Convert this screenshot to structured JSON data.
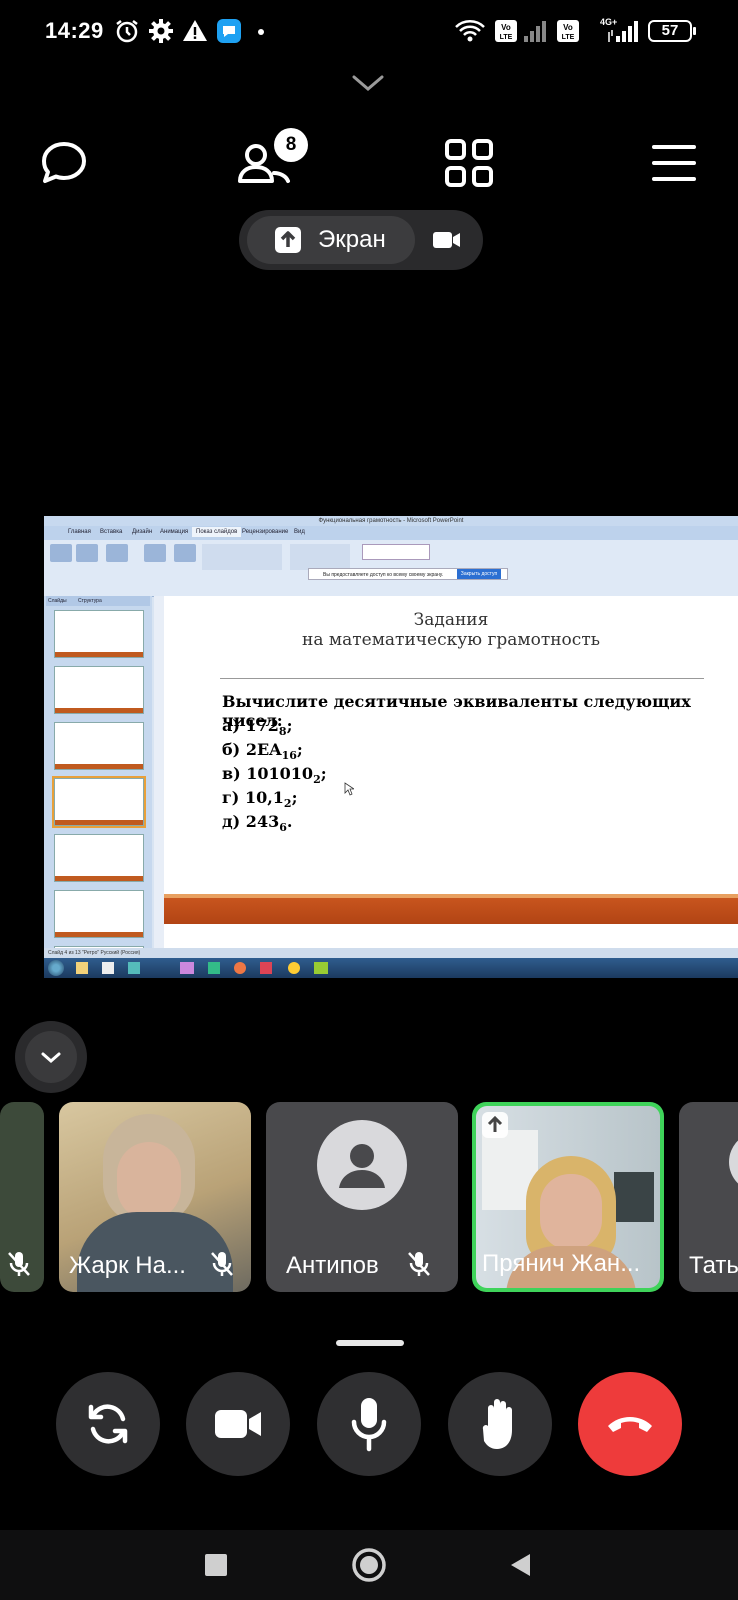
{
  "status_bar": {
    "time": "14:29",
    "icons": [
      "alarm-icon",
      "gear-icon",
      "warning-icon",
      "chat-app-icon",
      "dot-icon",
      "wifi-icon",
      "volte-icon",
      "signal-icon",
      "volte-icon",
      "signal-4g-icon"
    ],
    "network_label": "4G+",
    "battery": "57"
  },
  "toolbar": {
    "participants_count": "8",
    "icons": [
      "chat-icon",
      "participants-icon",
      "grid-icon",
      "menu-icon"
    ]
  },
  "share_pill": {
    "label": "Экран"
  },
  "shared_screen": {
    "window_title": "Функциональная грамотность - Microsoft PowerPoint",
    "ribbon_tabs": [
      "Главная",
      "Вставка",
      "Дизайн",
      "Анимация",
      "Показ слайдов",
      "Рецензирование",
      "Вид"
    ],
    "notice_text": "Вы предоставляете доступ ко всему своему экрану.",
    "notice_button": "Закрыть доступ",
    "panel_tabs": [
      "Слайды",
      "Структура"
    ],
    "statusline": "Слайд 4 из 13    \"Ретро\"    Русский (Россия)",
    "slide": {
      "title_line1": "Задания",
      "title_line2": "на математическую грамотность",
      "main_text": "Вычислите десятичные эквиваленты следующих чисел:",
      "items": [
        {
          "prefix": "а) 172",
          "sub": "8",
          "suffix": ";"
        },
        {
          "prefix": "б) 2EA",
          "sub": "16",
          "suffix": ";"
        },
        {
          "prefix": "в) 101010",
          "sub": "2",
          "suffix": ";"
        },
        {
          "prefix": "г)  10,1",
          "sub": "2",
          "suffix": ";"
        },
        {
          "prefix": "д) 243",
          "sub": "6",
          "suffix": "."
        }
      ]
    }
  },
  "participants": [
    {
      "name": "",
      "muted": true
    },
    {
      "name": "Жарк На...",
      "muted": true
    },
    {
      "name": "Антипов",
      "muted": true
    },
    {
      "name": "Прянич Жан...",
      "muted": false,
      "active_speaker": true,
      "sharing": true
    },
    {
      "name": "Тать",
      "muted": false
    }
  ],
  "controls": [
    "switch-camera-icon",
    "camera-icon",
    "microphone-icon",
    "raise-hand-icon",
    "hang-up-icon"
  ],
  "colors": {
    "background": "#000000",
    "active_border": "#3fd35a",
    "hangup": "#ee3b3b",
    "control_bg": "#2f2f31"
  }
}
